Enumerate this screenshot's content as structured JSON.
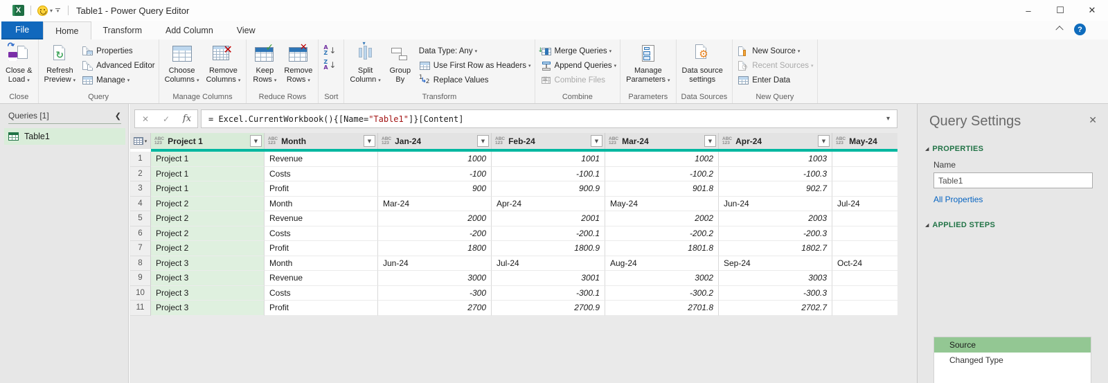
{
  "colors": {
    "accent_teal": "#00B7A0",
    "brand_green": "#217346",
    "file_tab_blue": "#1168BD",
    "selected_column_bg": "#DFF0DF",
    "selected_step_bg": "#93C793",
    "link_blue": "#0563C1",
    "formula_string_red": "#A31515"
  },
  "window": {
    "title": "Table1 - Power Query Editor",
    "controls": {
      "minimize_icon": "–",
      "maximize_icon": "☐",
      "close_icon": "✕"
    }
  },
  "tabs": [
    {
      "label": "File"
    },
    {
      "label": "Home"
    },
    {
      "label": "Transform"
    },
    {
      "label": "Add Column"
    },
    {
      "label": "View"
    }
  ],
  "help_label": "?",
  "ribbon": {
    "groups": [
      {
        "label": "Close",
        "items": [
          {
            "kind": "big",
            "lines": [
              "Close &",
              "Load"
            ],
            "dropdown": true,
            "icon": "close-and-load"
          }
        ]
      },
      {
        "label": "Query",
        "items": [
          {
            "kind": "big",
            "lines": [
              "Refresh",
              "Preview"
            ],
            "dropdown": true,
            "icon": "refresh-preview"
          },
          {
            "kind": "col",
            "buttons": [
              {
                "label": "Properties",
                "icon": "properties"
              },
              {
                "label": "Advanced Editor",
                "icon": "advanced-editor"
              },
              {
                "label": "Manage",
                "dropdown": true,
                "icon": "manage-table"
              }
            ]
          }
        ]
      },
      {
        "label": "Manage Columns",
        "items": [
          {
            "kind": "big",
            "lines": [
              "Choose",
              "Columns"
            ],
            "dropdown": true,
            "icon": "choose-columns"
          },
          {
            "kind": "big",
            "lines": [
              "Remove",
              "Columns"
            ],
            "dropdown": true,
            "icon": "remove-columns"
          }
        ]
      },
      {
        "label": "Reduce Rows",
        "items": [
          {
            "kind": "big",
            "lines": [
              "Keep",
              "Rows"
            ],
            "dropdown": true,
            "icon": "keep-rows"
          },
          {
            "kind": "big",
            "lines": [
              "Remove",
              "Rows"
            ],
            "dropdown": true,
            "icon": "remove-rows"
          }
        ]
      },
      {
        "label": "Sort",
        "items": [
          {
            "kind": "col",
            "buttons": [
              {
                "label": "",
                "icon": "sort-ascending"
              },
              {
                "label": "",
                "icon": "sort-descending"
              }
            ]
          }
        ]
      },
      {
        "label": "Transform",
        "items": [
          {
            "kind": "big",
            "lines": [
              "Split",
              "Column"
            ],
            "dropdown": true,
            "icon": "split-column"
          },
          {
            "kind": "big",
            "lines": [
              "Group",
              "By"
            ],
            "icon": "group-by"
          },
          {
            "kind": "col",
            "buttons": [
              {
                "label": "Data Type: Any",
                "dropdown": true
              },
              {
                "label": "Use First Row as Headers",
                "dropdown": true,
                "icon": "table-header"
              },
              {
                "label": "Replace Values",
                "icon": "replace-values"
              }
            ]
          }
        ]
      },
      {
        "label": "Combine",
        "items": [
          {
            "kind": "col",
            "buttons": [
              {
                "label": "Merge Queries",
                "dropdown": true,
                "icon": "merge-queries"
              },
              {
                "label": "Append Queries",
                "dropdown": true,
                "icon": "append-queries"
              },
              {
                "label": "Combine Files",
                "icon": "combine-files",
                "disabled": true
              }
            ]
          }
        ]
      },
      {
        "label": "Parameters",
        "items": [
          {
            "kind": "big",
            "lines": [
              "Manage",
              "Parameters"
            ],
            "dropdown": true,
            "icon": "manage-parameters"
          }
        ]
      },
      {
        "label": "Data Sources",
        "items": [
          {
            "kind": "big",
            "lines": [
              "Data source",
              "settings"
            ],
            "icon": "data-source-settings"
          }
        ]
      },
      {
        "label": "New Query",
        "items": [
          {
            "kind": "col",
            "buttons": [
              {
                "label": "New Source",
                "dropdown": true,
                "icon": "new-source"
              },
              {
                "label": "Recent Sources",
                "dropdown": true,
                "icon": "recent-sources",
                "disabled": true
              },
              {
                "label": "Enter Data",
                "icon": "enter-data"
              }
            ]
          }
        ]
      }
    ]
  },
  "queries_pane": {
    "header": "Queries [1]",
    "collapse_icon": "❮",
    "items": [
      {
        "label": "Table1",
        "selected": true
      }
    ]
  },
  "formula_bar": {
    "cancel_icon": "✕",
    "accept_icon": "✓",
    "fx_label": "fx",
    "prefix": "= Excel.CurrentWorkbook(){[Name=",
    "string": "\"Table1\"",
    "suffix": "]}[Content]",
    "expand_icon": "▾"
  },
  "grid": {
    "columns": [
      "Project 1",
      "Month",
      "Jan-24",
      "Feb-24",
      "Mar-24",
      "Apr-24",
      "May-24"
    ],
    "column_type_badge": "ABC|123",
    "selected_column": "Project 1",
    "rows": [
      {
        "n": "1",
        "cells": [
          "Project 1",
          "Revenue",
          "1000",
          "1001",
          "1002",
          "1003",
          ""
        ]
      },
      {
        "n": "2",
        "cells": [
          "Project 1",
          "Costs",
          "-100",
          "-100.1",
          "-100.2",
          "-100.3",
          ""
        ]
      },
      {
        "n": "3",
        "cells": [
          "Project 1",
          "Profit",
          "900",
          "900.9",
          "901.8",
          "902.7",
          ""
        ]
      },
      {
        "n": "4",
        "cells": [
          "Project 2",
          "Month",
          "Mar-24",
          "Apr-24",
          "May-24",
          "Jun-24",
          "Jul-24"
        ]
      },
      {
        "n": "5",
        "cells": [
          "Project 2",
          "Revenue",
          "2000",
          "2001",
          "2002",
          "2003",
          ""
        ]
      },
      {
        "n": "6",
        "cells": [
          "Project 2",
          "Costs",
          "-200",
          "-200.1",
          "-200.2",
          "-200.3",
          ""
        ]
      },
      {
        "n": "7",
        "cells": [
          "Project 2",
          "Profit",
          "1800",
          "1800.9",
          "1801.8",
          "1802.7",
          ""
        ]
      },
      {
        "n": "8",
        "cells": [
          "Project 3",
          "Month",
          "Jun-24",
          "Jul-24",
          "Aug-24",
          "Sep-24",
          "Oct-24"
        ]
      },
      {
        "n": "9",
        "cells": [
          "Project 3",
          "Revenue",
          "3000",
          "3001",
          "3002",
          "3003",
          ""
        ]
      },
      {
        "n": "10",
        "cells": [
          "Project 3",
          "Costs",
          "-300",
          "-300.1",
          "-300.2",
          "-300.3",
          ""
        ]
      },
      {
        "n": "11",
        "cells": [
          "Project 3",
          "Profit",
          "2700",
          "2700.9",
          "2701.8",
          "2702.7",
          ""
        ]
      }
    ]
  },
  "settings_panel": {
    "title": "Query Settings",
    "close_icon": "✕",
    "properties_header": "PROPERTIES",
    "name_label": "Name",
    "name_value": "Table1",
    "all_properties_link": "All Properties",
    "applied_steps_header": "APPLIED STEPS",
    "steps": [
      {
        "label": "Source",
        "selected": true
      },
      {
        "label": "Changed Type",
        "selected": false
      }
    ]
  }
}
